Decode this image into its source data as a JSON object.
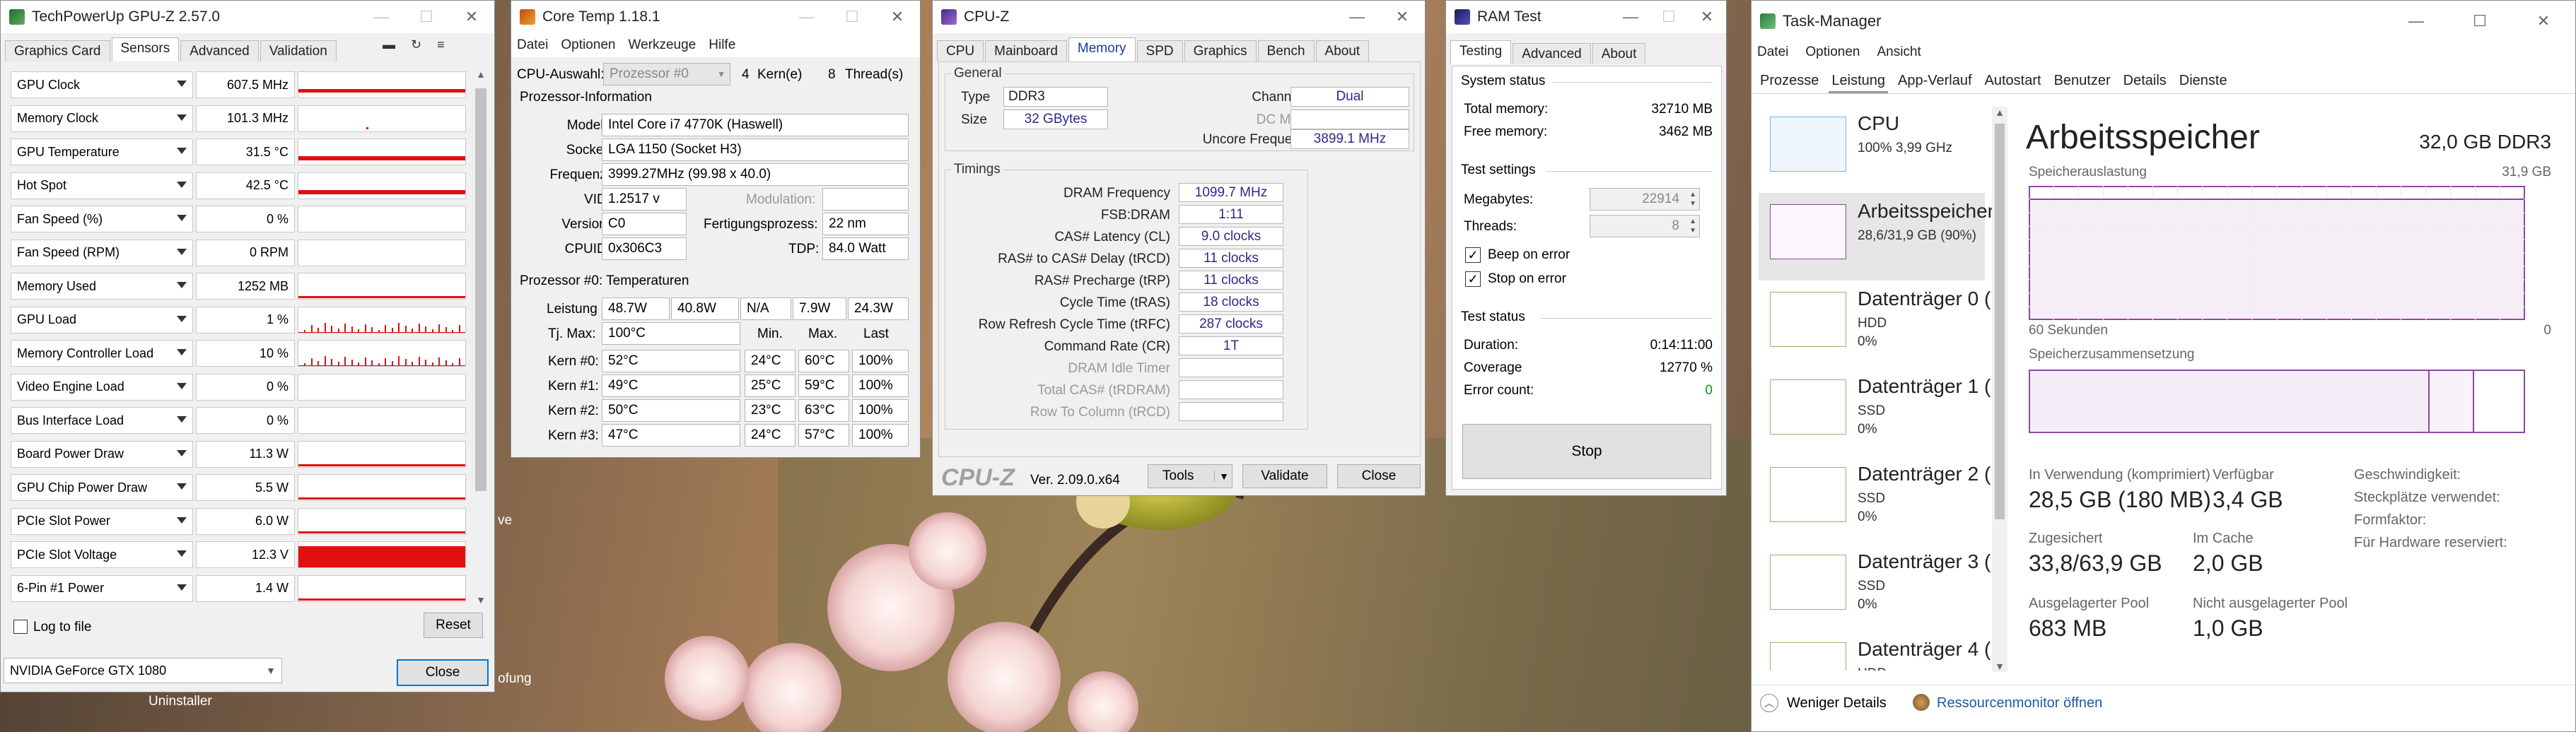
{
  "desktop": {
    "partial_label_1": "ve",
    "partial_label_2": "Uninstaller",
    "partial_label_3": "ofung"
  },
  "gpuz": {
    "title": "TechPowerUp GPU-Z 2.57.0",
    "tabs": [
      "Graphics Card",
      "Sensors",
      "Advanced",
      "Validation"
    ],
    "active_tab": 1,
    "sensors": [
      {
        "label": "GPU Clock",
        "value": "607.5 MHz",
        "graph": "spiky"
      },
      {
        "label": "Memory Clock",
        "value": "101.3 MHz",
        "graph": "low"
      },
      {
        "label": "GPU Temperature",
        "value": "31.5 °C",
        "graph": "flat-mid"
      },
      {
        "label": "Hot Spot",
        "value": "42.5 °C",
        "graph": "flat-mid"
      },
      {
        "label": "Fan Speed (%)",
        "value": "0 %",
        "graph": "none"
      },
      {
        "label": "Fan Speed (RPM)",
        "value": "0 RPM",
        "graph": "none"
      },
      {
        "label": "Memory Used",
        "value": "1252 MB",
        "graph": "flat-low"
      },
      {
        "label": "GPU Load",
        "value": "1 %",
        "graph": "spikes"
      },
      {
        "label": "Memory Controller Load",
        "value": "10 %",
        "graph": "spikes"
      },
      {
        "label": "Video Engine Load",
        "value": "0 %",
        "graph": "none"
      },
      {
        "label": "Bus Interface Load",
        "value": "0 %",
        "graph": "none"
      },
      {
        "label": "Board Power Draw",
        "value": "11.3 W",
        "graph": "flat-low"
      },
      {
        "label": "GPU Chip Power Draw",
        "value": "5.5 W",
        "graph": "flat-low"
      },
      {
        "label": "PCIe Slot Power",
        "value": "6.0 W",
        "graph": "flat-low"
      },
      {
        "label": "PCIe Slot Voltage",
        "value": "12.3 V",
        "graph": "full"
      },
      {
        "label": "6-Pin #1 Power",
        "value": "1.4 W",
        "graph": "flat-low"
      }
    ],
    "log_to_file": "Log to file",
    "reset": "Reset",
    "gpu_select": "NVIDIA GeForce GTX 1080",
    "close": "Close",
    "graph_color": "#e01010"
  },
  "coretemp": {
    "title": "Core Temp 1.18.1",
    "menu": [
      "Datei",
      "Optionen",
      "Werkzeuge",
      "Hilfe"
    ],
    "cpu_select_label": "CPU-Auswahl:",
    "cpu_select_value": "Prozessor #0",
    "cores_count": "4",
    "cores_label": "Kern(e)",
    "threads_count": "8",
    "threads_label": "Thread(s)",
    "info_header": "Prozessor-Information",
    "model_label": "Modell:",
    "model": "Intel Core i7 4770K (Haswell)",
    "socket_label": "Sockel:",
    "socket": "LGA 1150 (Socket H3)",
    "freq_label": "Frequenz:",
    "freq": "3999.27MHz (99.98 x 40.0)",
    "vid_label": "VID:",
    "vid": "1.2517 v",
    "modulation_label": "Modulation:",
    "version_label": "Version:",
    "version": "C0",
    "process_label": "Fertigungsprozess:",
    "process": "22 nm",
    "cpuid_label": "CPUID:",
    "cpuid": "0x306C3",
    "tdp_label": "TDP:",
    "tdp": "84.0 Watt",
    "temp_header": "Prozessor #0: Temperaturen",
    "power_label": "Leistung",
    "power": [
      "48.7W",
      "40.8W",
      "N/A",
      "7.9W",
      "24.3W"
    ],
    "tjmax_label": "Tj. Max:",
    "tjmax": "100°C",
    "col_min": "Min.",
    "col_max": "Max.",
    "col_last": "Last",
    "cores": [
      {
        "name": "Kern #0:",
        "temp": "52°C",
        "min": "24°C",
        "max": "60°C",
        "load": "100%"
      },
      {
        "name": "Kern #1:",
        "temp": "49°C",
        "min": "25°C",
        "max": "59°C",
        "load": "100%"
      },
      {
        "name": "Kern #2:",
        "temp": "50°C",
        "min": "23°C",
        "max": "63°C",
        "load": "100%"
      },
      {
        "name": "Kern #3:",
        "temp": "47°C",
        "min": "24°C",
        "max": "57°C",
        "load": "100%"
      }
    ]
  },
  "cpuz": {
    "title": "CPU-Z",
    "tabs": [
      "CPU",
      "Mainboard",
      "Memory",
      "SPD",
      "Graphics",
      "Bench",
      "About"
    ],
    "active_tab": 2,
    "general_label": "General",
    "type_label": "Type",
    "type": "DDR3",
    "size_label": "Size",
    "size": "32 GBytes",
    "channel_label": "Channel #",
    "channel": "Dual",
    "dcmode_label": "DC Mode",
    "dcmode": "",
    "uncore_label": "Uncore Frequency",
    "uncore": "3899.1 MHz",
    "timings_label": "Timings",
    "timings": [
      {
        "label": "DRAM Frequency",
        "value": "1099.7 MHz",
        "disabled": false
      },
      {
        "label": "FSB:DRAM",
        "value": "1:11",
        "disabled": false
      },
      {
        "label": "CAS# Latency (CL)",
        "value": "9.0 clocks",
        "disabled": false
      },
      {
        "label": "RAS# to CAS# Delay (tRCD)",
        "value": "11 clocks",
        "disabled": false
      },
      {
        "label": "RAS# Precharge (tRP)",
        "value": "11 clocks",
        "disabled": false
      },
      {
        "label": "Cycle Time (tRAS)",
        "value": "18 clocks",
        "disabled": false
      },
      {
        "label": "Row Refresh Cycle Time (tRFC)",
        "value": "287 clocks",
        "disabled": false
      },
      {
        "label": "Command Rate (CR)",
        "value": "1T",
        "disabled": false
      },
      {
        "label": "DRAM Idle Timer",
        "value": "",
        "disabled": true
      },
      {
        "label": "Total CAS# (tRDRAM)",
        "value": "",
        "disabled": true
      },
      {
        "label": "Row To Column (tRCD)",
        "value": "",
        "disabled": true
      }
    ],
    "brand": "CPU-Z",
    "version": "Ver. 2.09.0.x64",
    "tools": "Tools",
    "validate": "Validate",
    "close": "Close"
  },
  "ramtest": {
    "title": "RAM Test",
    "tabs": [
      "Testing",
      "Advanced",
      "About"
    ],
    "active_tab": 0,
    "system_status_label": "System status",
    "total_mem_label": "Total memory:",
    "total_mem": "32710 MB",
    "free_mem_label": "Free memory:",
    "free_mem": "3462 MB",
    "settings_label": "Test settings",
    "megabytes_label": "Megabytes:",
    "megabytes": "22914",
    "threads_label": "Threads:",
    "threads": "8",
    "beep_label": "Beep on error",
    "stop_on_error_label": "Stop on error",
    "test_status_label": "Test status",
    "duration_label": "Duration:",
    "duration": "0:14:11:00",
    "coverage_label": "Coverage",
    "coverage": "12770 %",
    "errors_label": "Error count:",
    "errors": "0",
    "stop": "Stop"
  },
  "taskmgr": {
    "title": "Task-Manager",
    "menu": [
      "Datei",
      "Optionen",
      "Ansicht"
    ],
    "tabs": [
      "Prozesse",
      "Leistung",
      "App-Verlauf",
      "Autostart",
      "Benutzer",
      "Details",
      "Dienste"
    ],
    "active_tab": 1,
    "side": [
      {
        "name": "CPU",
        "line1": "100% 3,99 GHz",
        "line2": ""
      },
      {
        "name": "Arbeitsspeicher",
        "line1": "28,6/31,9 GB (90%)",
        "line2": ""
      },
      {
        "name": "Datenträger 0 (",
        "line1": "HDD",
        "line2": "0%"
      },
      {
        "name": "Datenträger 1 (",
        "line1": "SSD",
        "line2": "0%"
      },
      {
        "name": "Datenträger 2 (",
        "line1": "SSD",
        "line2": "0%"
      },
      {
        "name": "Datenträger 3 (",
        "line1": "SSD",
        "line2": "0%"
      },
      {
        "name": "Datenträger 4 (",
        "line1": "HDD",
        "line2": ""
      }
    ],
    "main_title": "Arbeitsspeicher",
    "main_capacity": "32,0 GB DDR3",
    "usage_label": "Speicherauslastung",
    "usage_max": "31,9 GB",
    "axis_left": "60 Sekunden",
    "axis_right": "0",
    "composition_label": "Speicherzusammensetzung",
    "in_use_label": "In Verwendung (komprimiert)",
    "in_use": "28,5 GB (180 MB)",
    "available_label": "Verfügbar",
    "available": "3,4 GB",
    "committed_label": "Zugesichert",
    "committed": "33,8/63,9 GB",
    "cached_label": "Im Cache",
    "cached": "2,0 GB",
    "paged_label": "Ausgelagerter Pool",
    "paged": "683 MB",
    "nonpaged_label": "Nicht ausgelagerter Pool",
    "nonpaged": "1,0 GB",
    "speed_label": "Geschwindigkeit:",
    "slots_label": "Steckplätze verwendet:",
    "formfactor_label": "Formfaktor:",
    "reserved_label": "Für Hardware reserviert:",
    "fewer_details": "Weniger Details",
    "resmon": "Ressourcenmonitor öffnen",
    "accent": "#8b4a9c",
    "used_fraction": 0.9
  }
}
